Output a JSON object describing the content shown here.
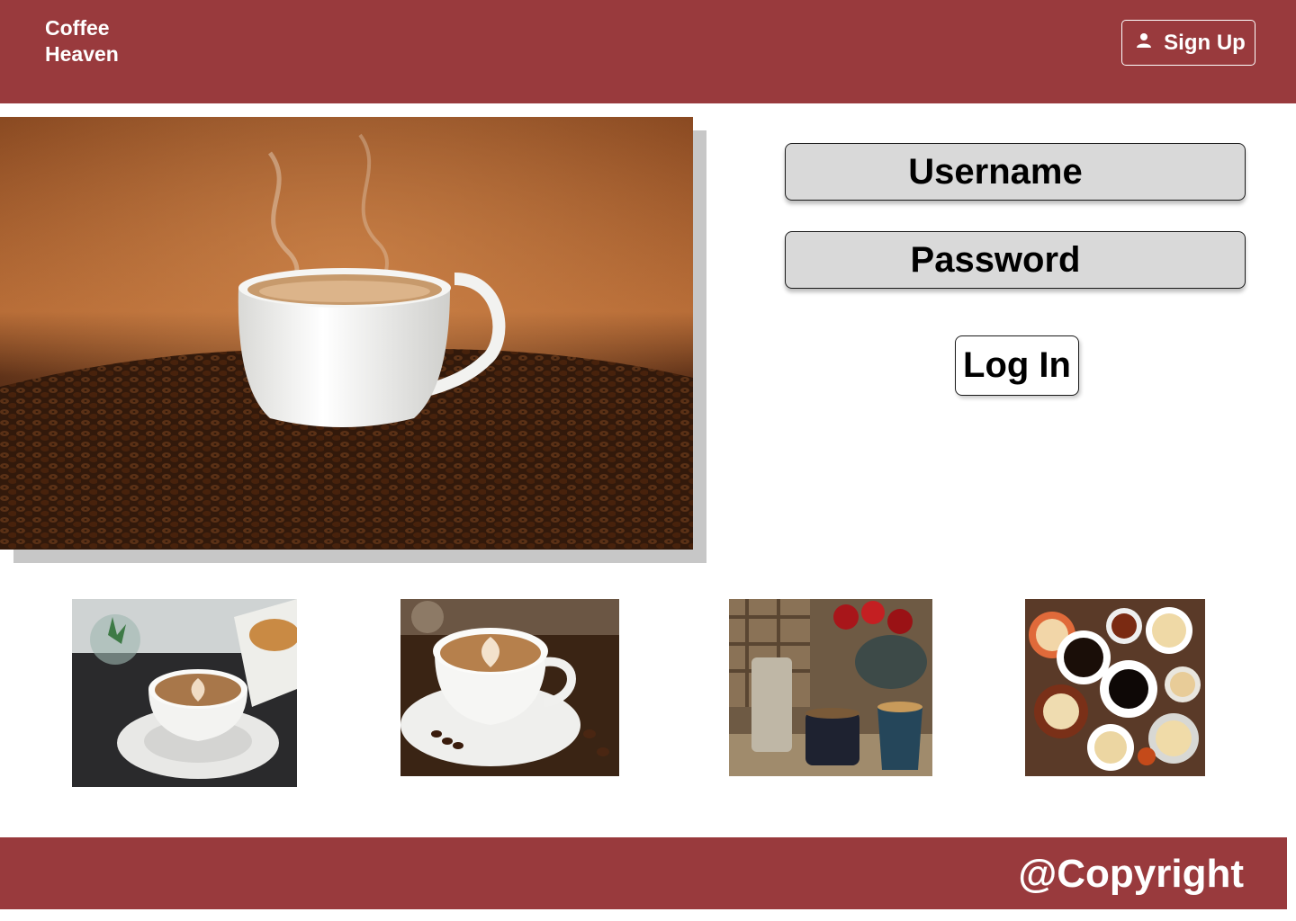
{
  "header": {
    "brand_line1": "Coffee",
    "brand_line2": "Heaven",
    "signup_label": "Sign Up",
    "signup_icon": "user-icon"
  },
  "login": {
    "username_label": "Username",
    "password_label": "Password",
    "login_label": "Log In"
  },
  "footer": {
    "copyright": "@Copyright"
  },
  "colors": {
    "brand": "#993a3d",
    "field_bg": "#d9d9d9"
  }
}
